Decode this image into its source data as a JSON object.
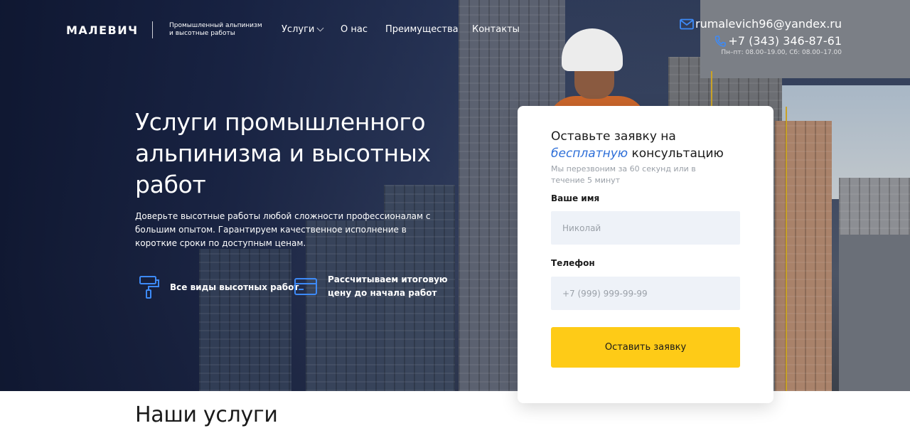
{
  "header": {
    "logo": "МАЛЕВИЧ",
    "tagline_line1": "Промышленный альпинизм",
    "tagline_line2": "и высотные работы",
    "nav": {
      "services": "Услуги",
      "about": "О нас",
      "advantages": "Преимущества",
      "contacts": "Контакты"
    },
    "email": "rumalevich96@yandex.ru",
    "phone": "+7 (343) 346-87-61",
    "hours": "Пн–пт: 08.00–19.00, Сб: 08.00–17.00"
  },
  "hero": {
    "title": "Услуги промышленного альпинизма и высотных работ",
    "description": "Доверьте высотные работы любой сложности профессионалам с большим опытом. Гарантируем качественное исполнение в короткие сроки по доступным ценам.",
    "features": [
      {
        "icon": "paint-roller-icon",
        "text": "Все виды высотных работ"
      },
      {
        "icon": "credit-card-icon",
        "text": "Рассчитываем итоговую цену до начала работ"
      }
    ]
  },
  "form": {
    "title_prefix": "Оставьте заявку на",
    "title_accent": "бесплатную",
    "title_suffix": "консультацию",
    "subtitle": "Мы перезвоним за 60 секунд или в течение 5 минут",
    "name_label": "Ваше имя",
    "name_placeholder": "Николай",
    "phone_label": "Телефон",
    "phone_placeholder": "+7 (999) 999-99-99",
    "submit": "Оставить заявку"
  },
  "services": {
    "title": "Наши услуги"
  },
  "colors": {
    "accent_yellow": "#fecb17",
    "accent_blue": "#2e6fd8",
    "hero_dark": "#0e1630"
  }
}
